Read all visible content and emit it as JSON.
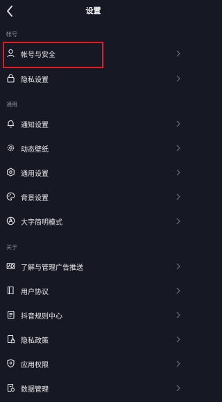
{
  "header": {
    "title": "设置"
  },
  "sections": [
    {
      "label": "帐号",
      "items": [
        {
          "label": "帐号与安全",
          "icon": "person-icon"
        },
        {
          "label": "隐私设置",
          "icon": "lock-icon"
        }
      ]
    },
    {
      "label": "通用",
      "items": [
        {
          "label": "通知设置",
          "icon": "bell-icon"
        },
        {
          "label": "动态壁纸",
          "icon": "gear-wallpaper-icon"
        },
        {
          "label": "通用设置",
          "icon": "gear-icon"
        },
        {
          "label": "背景设置",
          "icon": "palette-icon"
        },
        {
          "label": "大字简明模式",
          "icon": "text-mode-icon"
        }
      ]
    },
    {
      "label": "关于",
      "items": [
        {
          "label": "了解与管理广告推送",
          "icon": "ad-icon"
        },
        {
          "label": "用户协议",
          "icon": "book-icon"
        },
        {
          "label": "抖音规则中心",
          "icon": "rules-icon"
        },
        {
          "label": "隐私政策",
          "icon": "lock-doc-icon"
        },
        {
          "label": "应用权限",
          "icon": "shield-icon"
        },
        {
          "label": "数据管理",
          "icon": "data-icon"
        }
      ]
    }
  ],
  "colors": {
    "background": "#161823",
    "highlight": "#e01b24"
  }
}
